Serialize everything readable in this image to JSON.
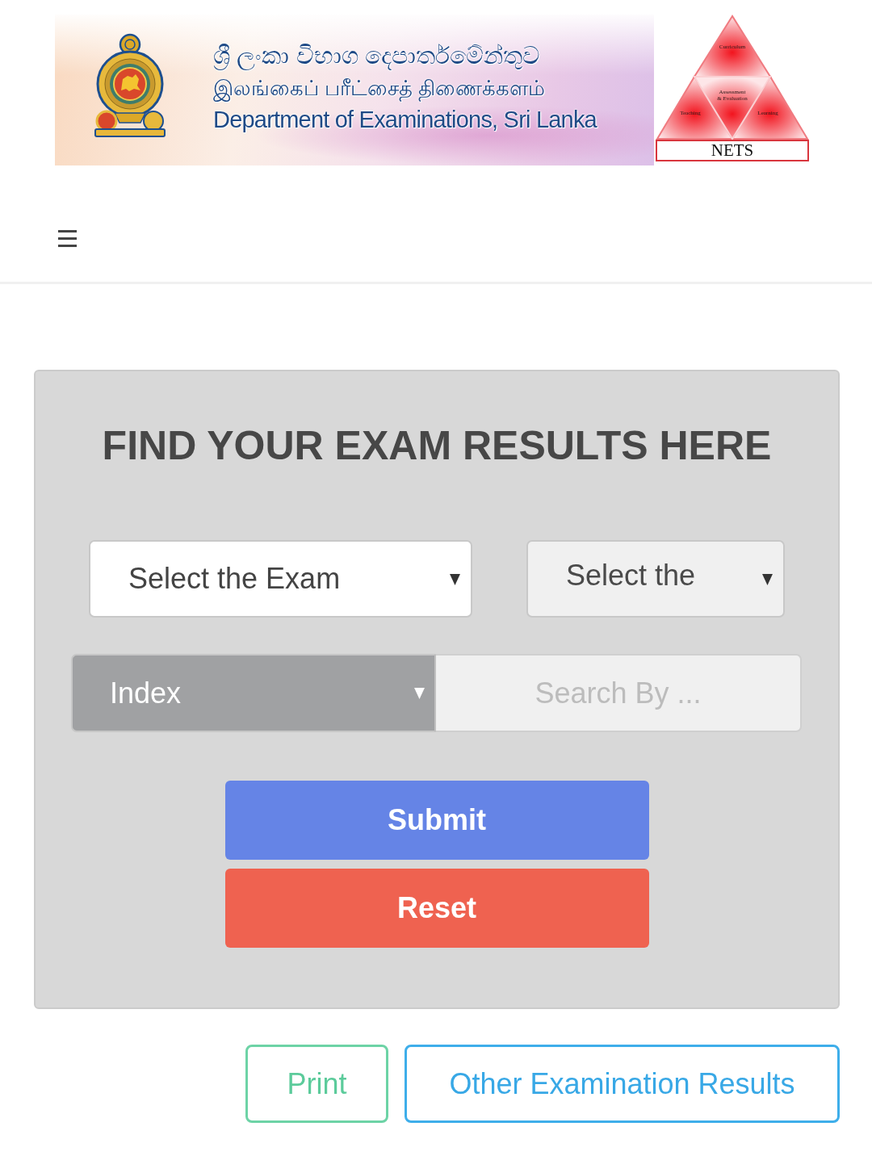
{
  "header": {
    "banner": {
      "lines": [
        "ශ්‍රී ලංකා විභාග දෙපාර්තමේන්තුව",
        "இலங்கைப் பரீட்சைத் திணைக்களம்",
        "Department of Examinations, Sri Lanka"
      ],
      "logo": {
        "segments": [
          "Curriculum",
          "Assessment & Evaluation",
          "Teaching",
          "Learning"
        ],
        "label": "NETS"
      }
    }
  },
  "form": {
    "title": "FIND YOUR EXAM RESULTS HERE",
    "selects": [
      {
        "value": "Select the Exam",
        "disabled": false
      },
      {
        "value": "Select the",
        "disabled": true
      }
    ],
    "search": {
      "mode": "Index",
      "placeholder": "Search By ..."
    },
    "buttons": [
      {
        "label": "Submit",
        "kind": "submit"
      },
      {
        "label": "Reset",
        "kind": "reset"
      }
    ]
  },
  "actions": [
    {
      "label": "Print",
      "kind": "print"
    },
    {
      "label": "Other Examination Results",
      "kind": "link"
    }
  ]
}
